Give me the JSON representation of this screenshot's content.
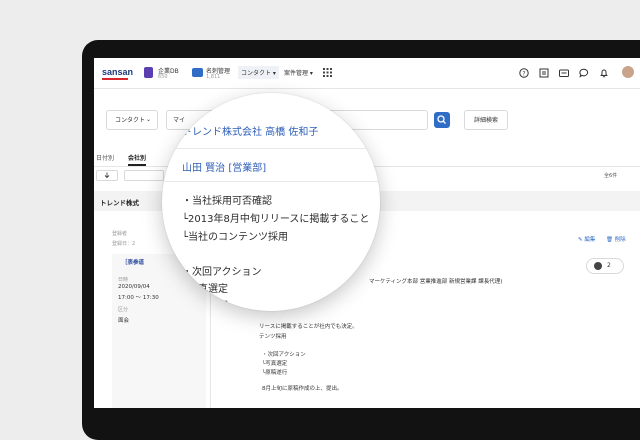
{
  "colors": {
    "brand_red": "#d9262c",
    "brand_navy": "#1d3a7a",
    "accent_blue": "#2f6dc7",
    "link_blue": "#2e5fb8",
    "app1": "#5b3fb0",
    "app2": "#2f6dc7"
  },
  "topbar": {
    "logo": "sansan",
    "apps": [
      {
        "name": "企業DB",
        "sub": "650"
      },
      {
        "name": "名刺管理",
        "sub": "1,811"
      }
    ],
    "menus": [
      {
        "label": "コンタクト ▾",
        "active": true
      },
      {
        "label": "案件管理 ▾",
        "active": false
      }
    ],
    "icons": [
      "help-icon",
      "news-icon",
      "card-icon",
      "chat-icon",
      "bell-icon"
    ]
  },
  "search": {
    "type_select": "コンタクト",
    "type_caret": "⌄",
    "query": "マイ",
    "advanced_label": "詳細検索"
  },
  "tabs": [
    {
      "label": "日付別"
    },
    {
      "label": "会社別",
      "active": true
    }
  ],
  "result_count": "全6件",
  "company_row": "トレンド株式",
  "detail": {
    "edit_label": "✎ 編集",
    "delete_label": "🗑 削除",
    "comment_count": "2",
    "tag": "［表参道",
    "fields": [
      {
        "label": "登録者",
        "value": ""
      },
      {
        "label": "登録日：2",
        "value": ""
      }
    ],
    "date_label": "日時",
    "date_value": "2020/09/04",
    "time_value": "17:00 〜 17:30",
    "type_label": "区分",
    "type_value": "面会",
    "attendee_line": "マーケティング本部 営業推進部 新規営業課 課長代理)",
    "body": [
      "リースに掲載することが社内でも決定。",
      "テンツ採用",
      "・次回アクション",
      "└写真選定",
      "└原稿遂行",
      "8月上旬に原稿作成の上、提出。"
    ]
  },
  "lens": {
    "company_contact": "トレンド株式会社 高橋 佐和子",
    "user": "山田 賢治 [営業部]",
    "lines": [
      "・当社採用可否確認",
      "└2013年8月中旬リリースに掲載すること",
      "└当社のコンテンツ採用",
      "・次回アクション",
      "└写真選定",
      "└原稿遂行"
    ]
  }
}
